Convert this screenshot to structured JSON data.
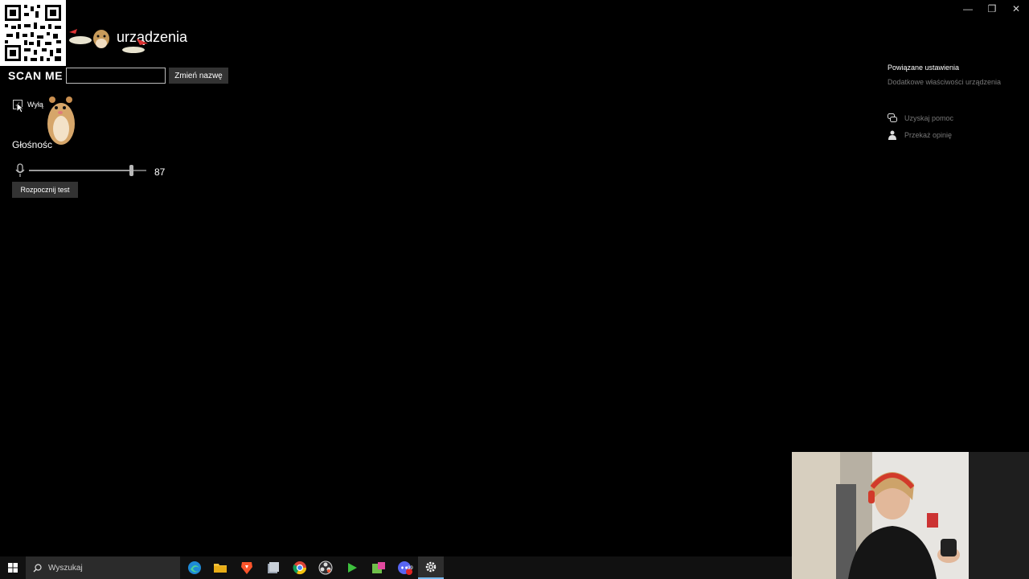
{
  "window": {
    "controls": {
      "minimize": "—",
      "restore": "❐",
      "close": "✕"
    }
  },
  "header": {
    "title_visible": "urządzenia"
  },
  "overlay": {
    "scan_label": "SCAN ME"
  },
  "device": {
    "name_input_value": "",
    "rename_button": "Zmień nazwę",
    "disable_checkbox_label": "Wyłą",
    "disable_checked": true
  },
  "volume": {
    "heading": "Głośnośc",
    "value_text": "87",
    "level": 0.87,
    "test_button": "Rozpocznij test"
  },
  "right_panel": {
    "heading": "Powiązane ustawienia",
    "link": "Dodatkowe właściwości urządzenia",
    "help": "Uzyskaj pomoc",
    "feedback": "Przekaż opinię"
  },
  "taskbar": {
    "search_placeholder": "Wyszukaj",
    "icons": [
      "edge-icon",
      "file-explorer-icon",
      "brave-icon",
      "files-icon",
      "chrome-icon",
      "obs-icon",
      "media-player-icon",
      "greenshot-icon",
      "discord-icon",
      "settings-icon"
    ],
    "badge": "99"
  },
  "colors": {
    "background": "#000000",
    "button": "#333333",
    "muted_text": "#777777",
    "taskbar": "#111111",
    "accent": "#76b9ed"
  }
}
